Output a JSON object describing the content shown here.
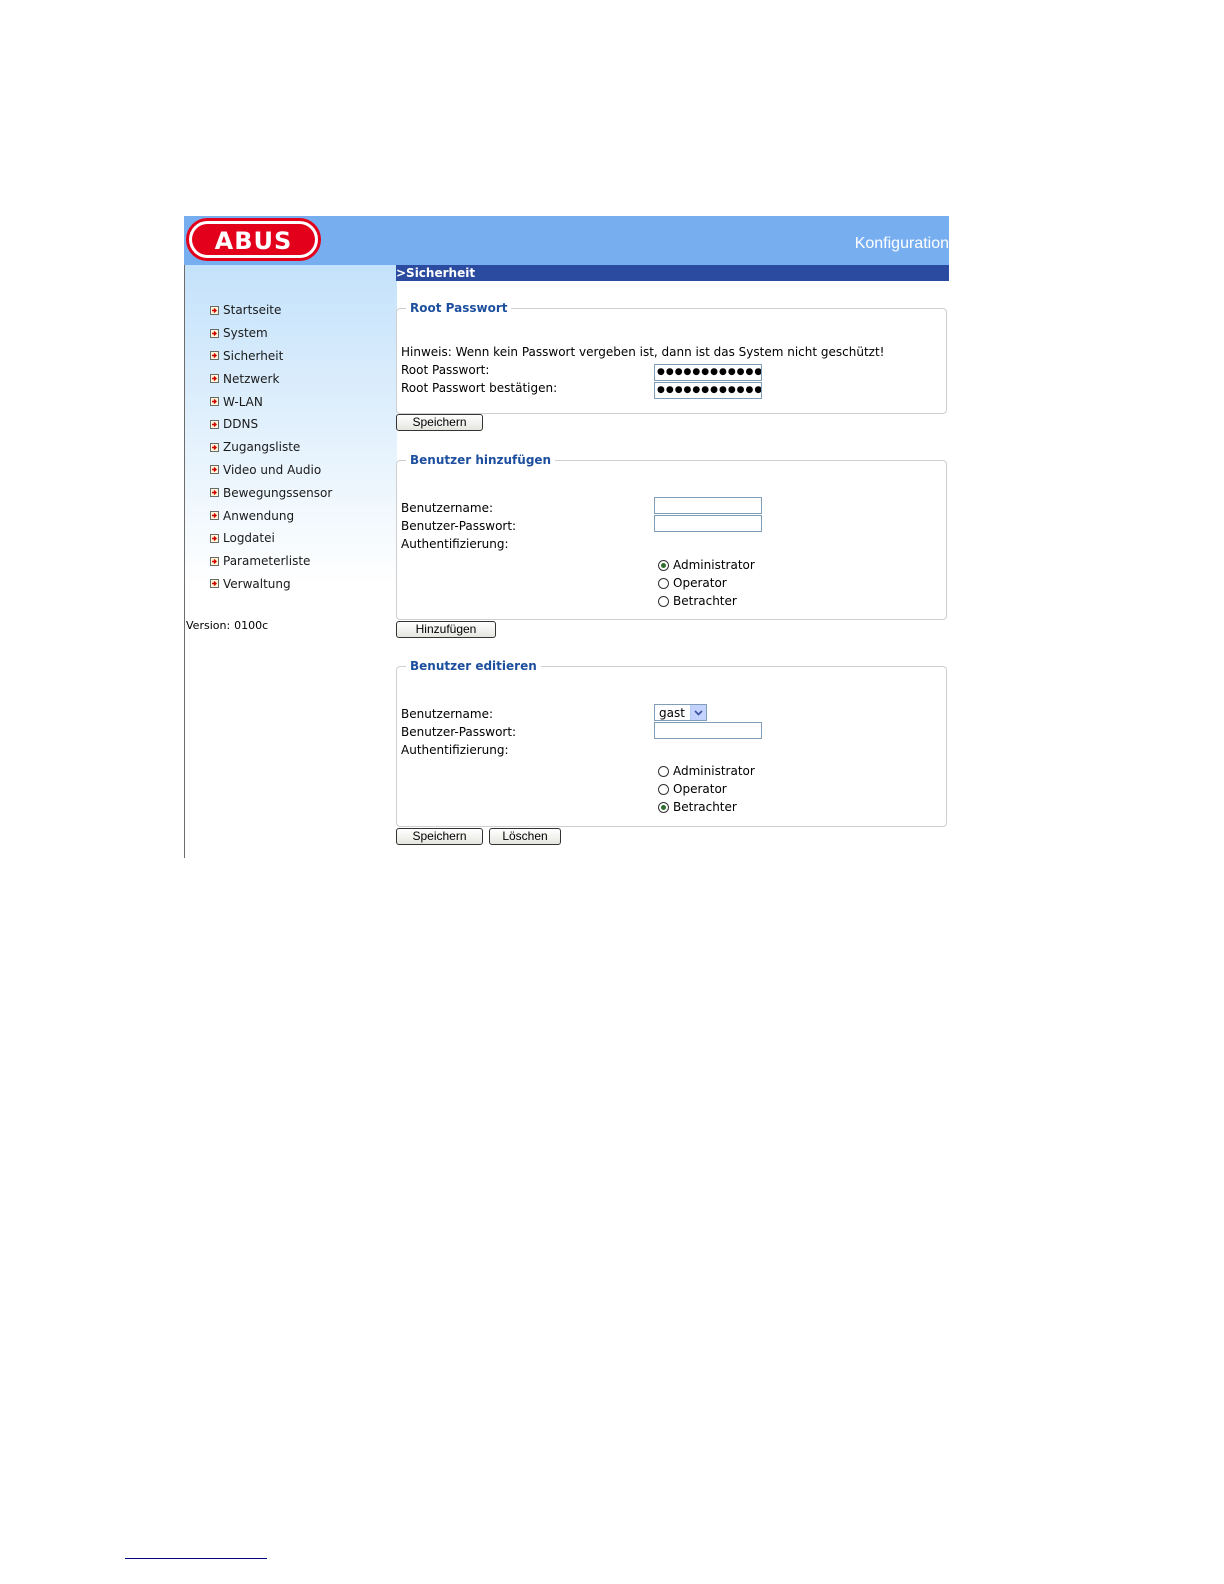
{
  "header": {
    "logo_text": "ABUS",
    "title": "Konfiguration"
  },
  "sidebar": {
    "items": [
      {
        "label": "Startseite"
      },
      {
        "label": "System"
      },
      {
        "label": "Sicherheit"
      },
      {
        "label": "Netzwerk"
      },
      {
        "label": "W-LAN"
      },
      {
        "label": "DDNS"
      },
      {
        "label": "Zugangsliste"
      },
      {
        "label": "Video und Audio"
      },
      {
        "label": "Bewegungssensor"
      },
      {
        "label": "Anwendung"
      },
      {
        "label": "Logdatei"
      },
      {
        "label": "Parameterliste"
      },
      {
        "label": "Verwaltung"
      }
    ],
    "version_label": "Version:",
    "version_value": "0100c"
  },
  "main": {
    "section_title": ">Sicherheit",
    "root": {
      "legend": "Root Passwort",
      "hint": "Hinweis: Wenn kein Passwort vergeben ist, dann ist das System nicht geschützt!",
      "password_label": "Root Passwort:",
      "password_value": "●●●●●●●●●●●●●●",
      "confirm_label": "Root Passwort bestätigen:",
      "confirm_value": "●●●●●●●●●●●●●●",
      "save_label": "Speichern"
    },
    "add_user": {
      "legend": "Benutzer hinzufügen",
      "username_label": "Benutzername:",
      "username_value": "",
      "password_label": "Benutzer-Passwort:",
      "password_value": "",
      "auth_label": "Authentifizierung:",
      "roles": [
        {
          "label": "Administrator",
          "checked": true
        },
        {
          "label": "Operator",
          "checked": false
        },
        {
          "label": "Betrachter",
          "checked": false
        }
      ],
      "add_label": "Hinzufügen"
    },
    "edit_user": {
      "legend": "Benutzer editieren",
      "username_label": "Benutzername:",
      "username_selected": "gast",
      "password_label": "Benutzer-Passwort:",
      "password_value": "",
      "auth_label": "Authentifizierung:",
      "roles": [
        {
          "label": "Administrator",
          "checked": false
        },
        {
          "label": "Operator",
          "checked": false
        },
        {
          "label": "Betrachter",
          "checked": true
        }
      ],
      "save_label": "Speichern",
      "delete_label": "Löschen"
    }
  },
  "colors": {
    "header_bg": "#77aef0",
    "section_bar": "#2b4ba0",
    "legend_text": "#1d4f9e",
    "logo_red": "#e2001a"
  }
}
